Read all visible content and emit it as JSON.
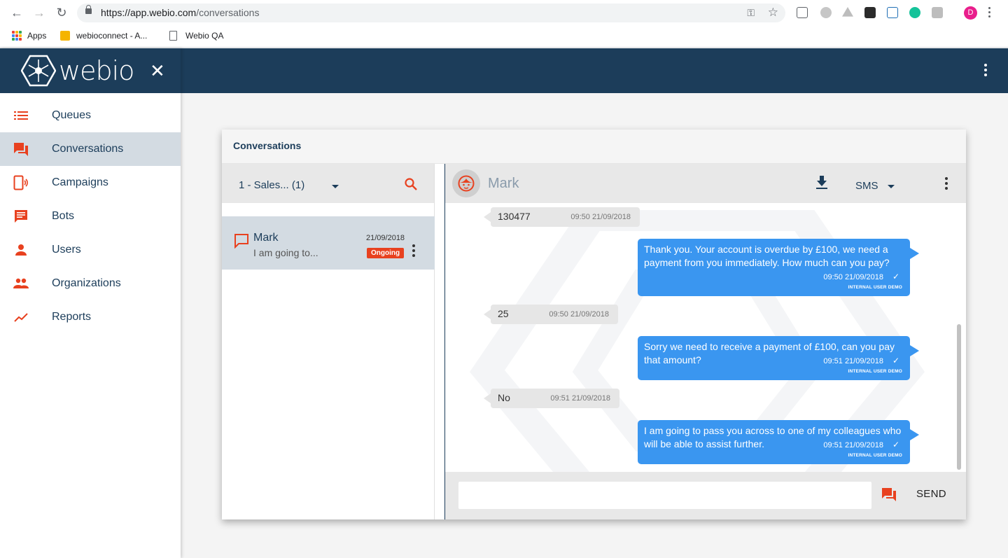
{
  "browser": {
    "url_host": "https://app.webio.com",
    "url_path": "/conversations",
    "bookmarks": [
      "Apps",
      "webioconnect - A...",
      "Webio QA"
    ],
    "profile_initial": "D"
  },
  "brand": {
    "name": "webio"
  },
  "sidebar": {
    "items": [
      {
        "label": "Queues",
        "icon": "list-icon"
      },
      {
        "label": "Conversations",
        "icon": "chat-icon"
      },
      {
        "label": "Campaigns",
        "icon": "phone-broadcast-icon"
      },
      {
        "label": "Bots",
        "icon": "message-square-icon"
      },
      {
        "label": "Users",
        "icon": "person-icon"
      },
      {
        "label": "Organizations",
        "icon": "people-icon"
      },
      {
        "label": "Reports",
        "icon": "trending-up-icon"
      }
    ],
    "active": "Conversations"
  },
  "card": {
    "title": "Conversations"
  },
  "queue_filter": {
    "selected": "1 - Sales... (1)"
  },
  "conversation_list": [
    {
      "name": "Mark",
      "preview": "I am going to...",
      "date": "21/09/2018",
      "status": "Ongoing"
    }
  ],
  "chat": {
    "contact_name": "Mark",
    "channel": "SMS",
    "messages": [
      {
        "direction": "in",
        "text": "130477",
        "time": "09:50 21/09/2018"
      },
      {
        "direction": "out",
        "text": "Thank you. Your account is overdue by £100, we need a payment from you immediately. How much can you pay?",
        "time": "09:50 21/09/2018",
        "sender": "INTERNAL USER DEMO"
      },
      {
        "direction": "in",
        "text": "25",
        "time": "09:50 21/09/2018"
      },
      {
        "direction": "out",
        "text": "Sorry we need to receive a payment of £100, can you pay that amount?",
        "time": "09:51 21/09/2018",
        "sender": "INTERNAL USER DEMO"
      },
      {
        "direction": "in",
        "text": "No",
        "time": "09:51 21/09/2018"
      },
      {
        "direction": "out",
        "text": "I am going to pass you across to one of my colleagues who will be able to assist further.",
        "time": "09:51 21/09/2018",
        "sender": "INTERNAL USER DEMO"
      }
    ],
    "composer": {
      "value": "",
      "send_label": "SEND"
    }
  },
  "colors": {
    "header": "#1c3d5a",
    "accent": "#e8411f",
    "outgoing_bubble": "#3a96f0",
    "incoming_bubble": "#e6e6e6",
    "active_item": "#d3dbe2"
  }
}
